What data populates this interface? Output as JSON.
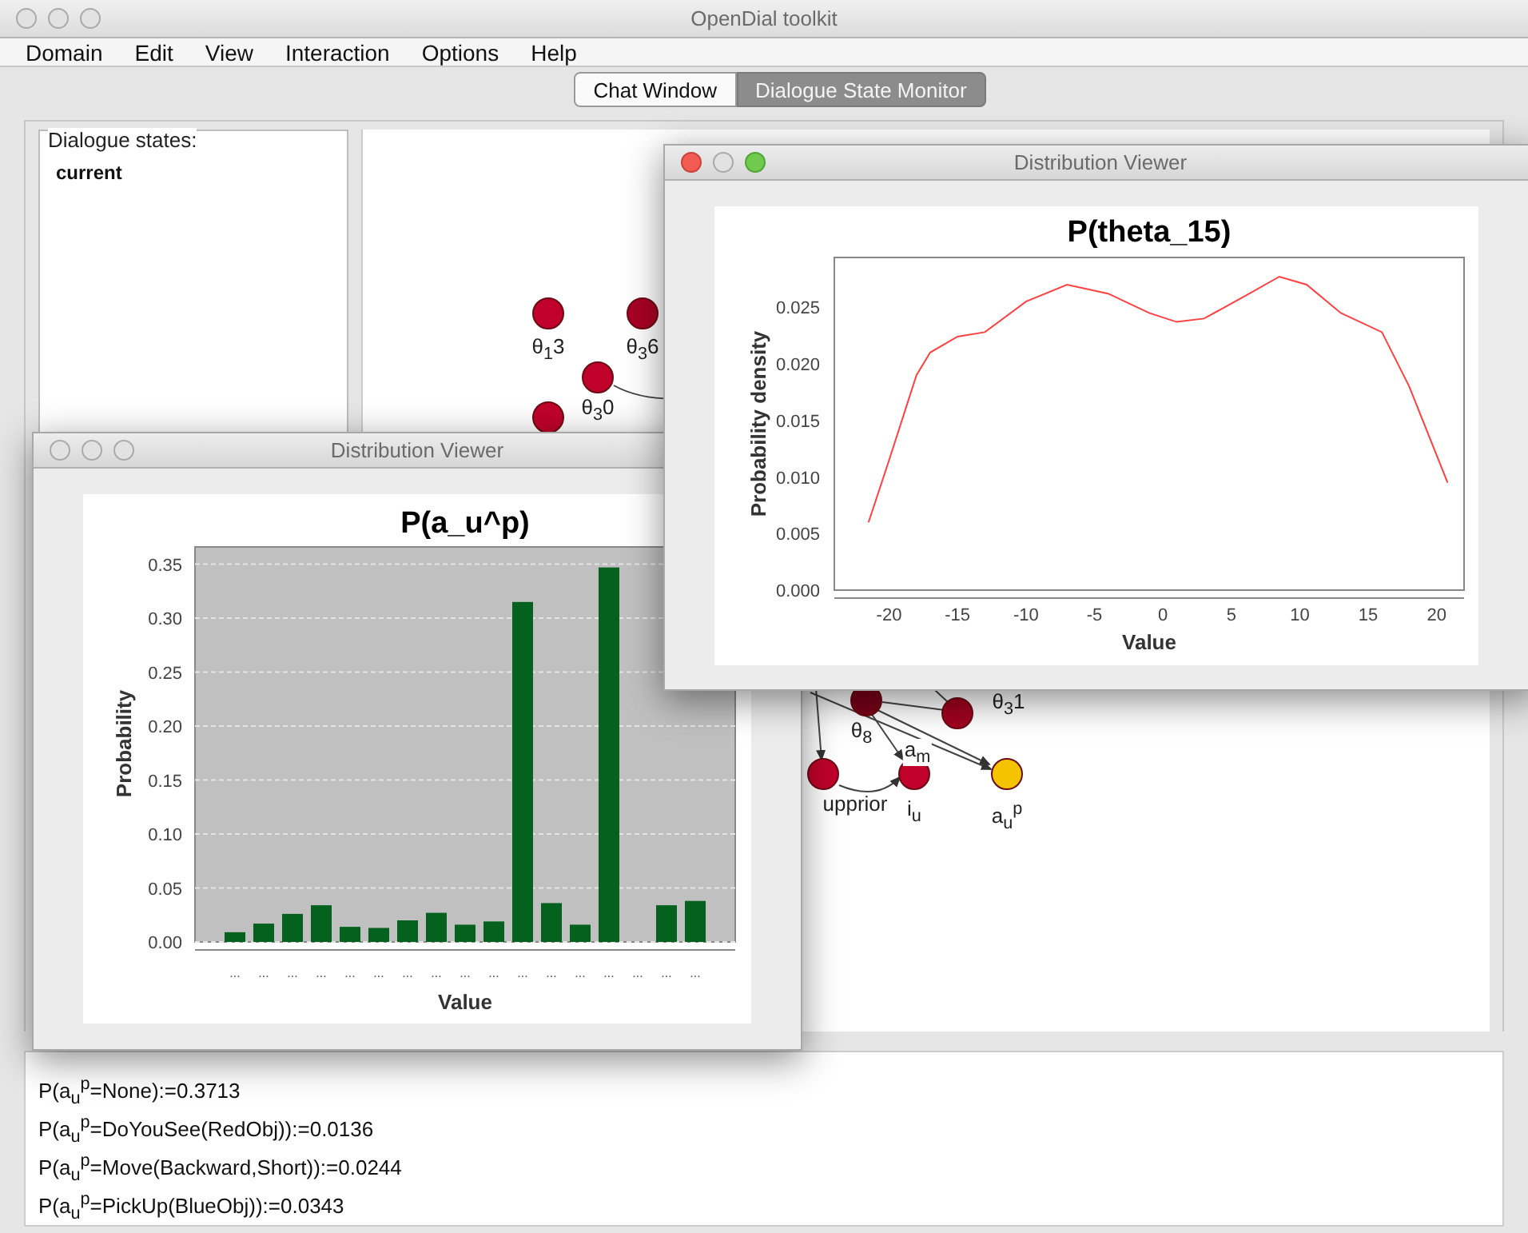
{
  "window": {
    "title": "OpenDial toolkit"
  },
  "menu": [
    "Domain",
    "Edit",
    "View",
    "Interaction",
    "Options",
    "Help"
  ],
  "tabs": [
    {
      "label": "Chat Window",
      "selected": false
    },
    {
      "label": "Dialogue State Monitor",
      "selected": true
    }
  ],
  "states_panel": {
    "title": "Dialogue states:",
    "items": [
      "current"
    ]
  },
  "graph": {
    "nodes": [
      {
        "label": "θ$_{1}$3",
        "color": "#c0022a"
      },
      {
        "label": "θ$_{3}$6",
        "color": "#a80225"
      },
      {
        "label": "θ$_{3}$0",
        "color": "#c0022a"
      },
      {
        "color": "#c0022a"
      },
      {
        "label": "θ$_{8}$",
        "color": "#7a0018"
      },
      {
        "label": "θ$_{3}$1",
        "color": "#a0021f"
      },
      {
        "label": "upprior",
        "color": "#c0022a"
      },
      {
        "label": "i$_{u}$",
        "color": "#c0022a"
      },
      {
        "label": "a$_{u}$$^{p}$",
        "color": "#f5c400"
      }
    ],
    "edge_labels": [
      "a$_{m}$"
    ]
  },
  "bar_viewer": {
    "title": "Distribution Viewer",
    "chart_data": {
      "type": "bar",
      "title": "P(a_u^p)",
      "xlabel": "Value",
      "ylabel": "Probability",
      "categories": [
        "...",
        "...",
        "...",
        "...",
        "...",
        "...",
        "...",
        "...",
        "...",
        "...",
        "...",
        "...",
        "...",
        "...",
        "...",
        "...",
        "..."
      ],
      "grid": true,
      "series": [
        {
          "color": "#05621e",
          "values": [
            0.009,
            0.017,
            0.026,
            0.034,
            0.014,
            0.013,
            0.02,
            0.027,
            0.016,
            0.019,
            0.315,
            0.036,
            0.016,
            0.347,
            0,
            0.034,
            0.038
          ]
        }
      ],
      "ylim": [
        0,
        0.366
      ],
      "yticks": [
        {
          "value": 0,
          "label": "0.00"
        },
        {
          "value": 0.05,
          "label": "0.05"
        },
        {
          "value": 0.1,
          "label": "0.10"
        },
        {
          "value": 0.15,
          "label": "0.15"
        },
        {
          "value": 0.2,
          "label": "0.20"
        },
        {
          "value": 0.25,
          "label": "0.25"
        },
        {
          "value": 0.3,
          "label": "0.30"
        },
        {
          "value": 0.35,
          "label": "0.35"
        }
      ]
    }
  },
  "density_viewer": {
    "title": "Distribution Viewer",
    "chart_data": {
      "type": "line",
      "title": "P(theta_15)",
      "xlabel": "Value",
      "ylabel": "Probability density",
      "x": [
        -21.5,
        -20,
        -18,
        -17,
        -15,
        -13,
        -10,
        -7,
        -4,
        -1,
        1,
        3,
        6,
        8.5,
        10.5,
        13,
        16,
        18,
        20.8
      ],
      "series": [
        {
          "color": "#ff4040",
          "values": [
            0.006,
            0.0115,
            0.019,
            0.021,
            0.0224,
            0.0228,
            0.0255,
            0.027,
            0.0262,
            0.0245,
            0.0237,
            0.024,
            0.026,
            0.0277,
            0.027,
            0.0245,
            0.0228,
            0.018,
            0.0095
          ]
        }
      ],
      "xlim": [
        -24,
        22
      ],
      "ylim": [
        0,
        0.0294
      ],
      "xticks": [
        -20,
        -15,
        -10,
        -5,
        0,
        5,
        10,
        15,
        20
      ],
      "yticks": [
        {
          "value": 0,
          "label": "0.000"
        },
        {
          "value": 0.005,
          "label": "0.005"
        },
        {
          "value": 0.01,
          "label": "0.010"
        },
        {
          "value": 0.015,
          "label": "0.015"
        },
        {
          "value": 0.02,
          "label": "0.020"
        },
        {
          "value": 0.025,
          "label": "0.025"
        }
      ]
    }
  },
  "output_lines": [
    "P(a$_{u}$$^{p}$=None):=0.3713",
    "P(a$_{u}$$^{p}$=DoYouSee(RedObj)):=0.0136",
    "P(a$_{u}$$^{p}$=Move(Backward,Short)):=0.0244",
    "P(a$_{u}$$^{p}$=PickUp(BlueObj)):=0.0343"
  ]
}
